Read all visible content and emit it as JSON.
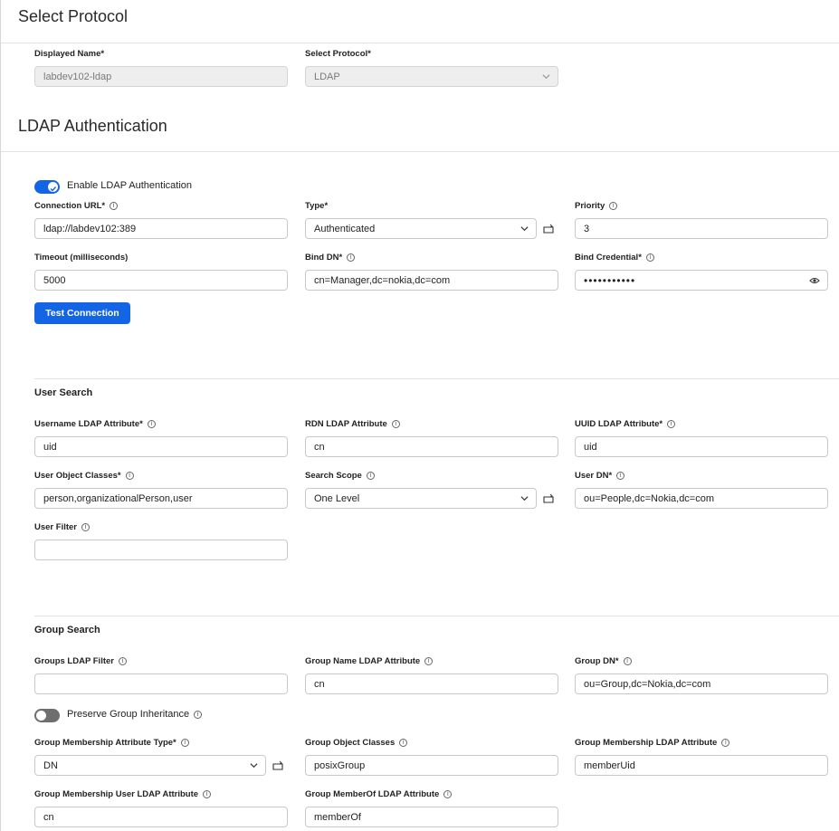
{
  "select_protocol": {
    "title": "Select Protocol",
    "displayed_name_label": "Displayed Name*",
    "displayed_name_value": "labdev102-ldap",
    "protocol_label": "Select Protocol*",
    "protocol_value": "LDAP"
  },
  "ldap_auth": {
    "title": "LDAP Authentication",
    "enable_label": "Enable LDAP Authentication",
    "enable_state": "on",
    "connection_url_label": "Connection URL*",
    "connection_url_value": "ldap://labdev102:389",
    "type_label": "Type*",
    "type_value": "Authenticated",
    "priority_label": "Priority",
    "priority_value": "3",
    "timeout_label": "Timeout (milliseconds)",
    "timeout_value": "5000",
    "bind_dn_label": "Bind DN*",
    "bind_dn_value": "cn=Manager,dc=nokia,dc=com",
    "bind_credential_label": "Bind Credential*",
    "bind_credential_value": "•••••••••••",
    "test_connection_label": "Test Connection"
  },
  "user_search": {
    "title": "User Search",
    "username_attr_label": "Username LDAP Attribute*",
    "username_attr_value": "uid",
    "rdn_attr_label": "RDN LDAP Attribute",
    "rdn_attr_value": "cn",
    "uuid_attr_label": "UUID LDAP Attribute*",
    "uuid_attr_value": "uid",
    "object_classes_label": "User Object Classes*",
    "object_classes_value": "person,organizationalPerson,user",
    "search_scope_label": "Search Scope",
    "search_scope_value": "One Level",
    "user_dn_label": "User DN*",
    "user_dn_value": "ou=People,dc=Nokia,dc=com",
    "user_filter_label": "User Filter",
    "user_filter_value": ""
  },
  "group_search": {
    "title": "Group Search",
    "groups_filter_label": "Groups LDAP Filter",
    "groups_filter_value": "",
    "group_name_attr_label": "Group Name LDAP Attribute",
    "group_name_attr_value": "cn",
    "group_dn_label": "Group DN*",
    "group_dn_value": "ou=Group,dc=Nokia,dc=com",
    "preserve_label": "Preserve Group Inheritance",
    "preserve_state": "off",
    "membership_type_label": "Group Membership Attribute Type*",
    "membership_type_value": "DN",
    "object_classes_label": "Group Object Classes",
    "object_classes_value": "posixGroup",
    "membership_attr_label": "Group Membership LDAP Attribute",
    "membership_attr_value": "memberUid",
    "membership_user_attr_label": "Group Membership User LDAP Attribute",
    "membership_user_attr_value": "cn",
    "memberof_attr_label": "Group MemberOf LDAP Attribute",
    "memberof_attr_value": "memberOf"
  },
  "icons": {
    "info": "info-icon",
    "chevron": "chevron-down-icon",
    "reload": "reload-icon",
    "eye": "eye-icon",
    "check": "check-icon"
  },
  "colors": {
    "accent": "#1465e6",
    "toggle_off": "#6e6e6e",
    "border": "#c9c9c9",
    "disabled_bg": "#eeeeee"
  }
}
